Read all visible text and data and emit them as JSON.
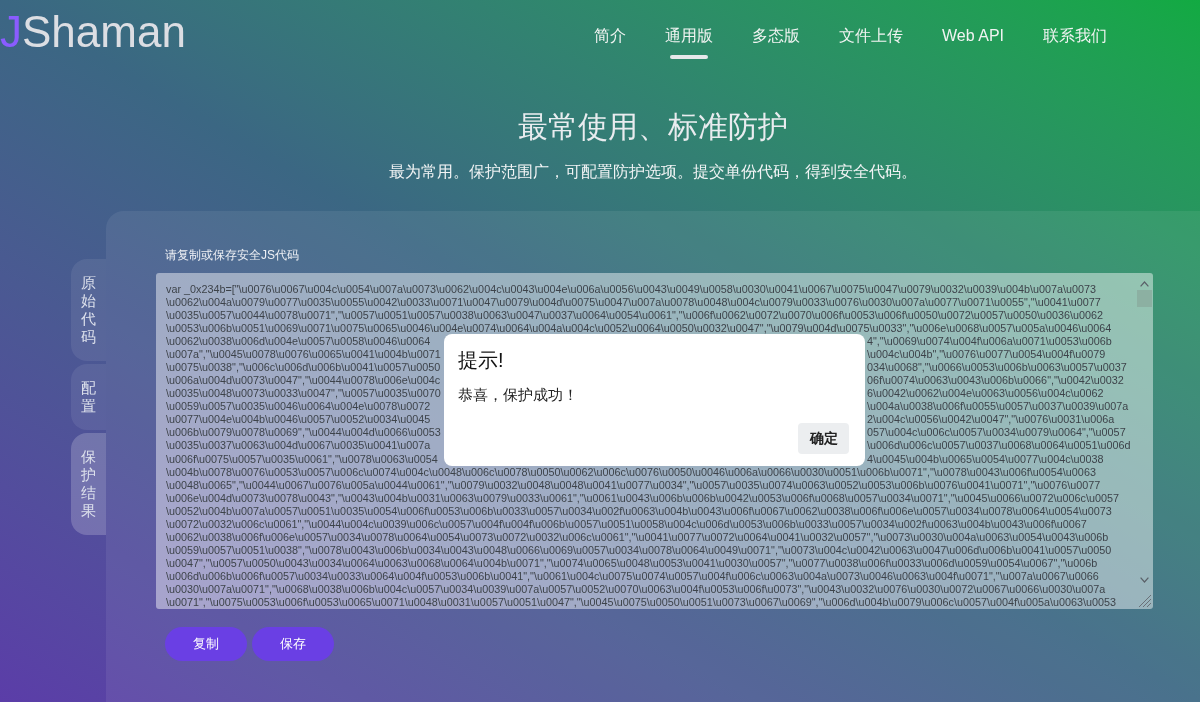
{
  "logo": {
    "accent": "J",
    "text": "Shaman"
  },
  "nav": [
    {
      "label": "简介",
      "selected": false
    },
    {
      "label": "通用版",
      "selected": true
    },
    {
      "label": "多态版",
      "selected": false
    },
    {
      "label": "文件上传",
      "selected": false
    },
    {
      "label": "Web API",
      "selected": false
    },
    {
      "label": "联系我们",
      "selected": false
    }
  ],
  "hero": {
    "title": "最常使用、标准防护",
    "subtitle": "最为常用。保护范围广，可配置防护选项。提交单份代码，得到安全代码。"
  },
  "side_tabs": [
    {
      "label": "原始代码",
      "selected": false
    },
    {
      "label": "配置",
      "selected": false
    },
    {
      "label": "保护结果",
      "selected": true
    }
  ],
  "output": {
    "label": "请复制或保存安全JS代码",
    "lines": [
      {
        "kind": "full",
        "text": "var _0x234b=[\"\\u0076\\u0067\\u004c\\u0054\\u007a\\u0073\\u0062\\u004c\\u0043\\u004e\\u006a\\u0056\\u0043\\u0049\\u0058\\u0030\\u0041\\u0067\\u0075\\u0047\\u0079\\u0032\\u0039\\u004b\\u007a\\u0073"
      },
      {
        "kind": "full",
        "text": "\\u0062\\u004a\\u0079\\u0077\\u0035\\u0055\\u0042\\u0033\\u0071\\u0047\\u0079\\u004d\\u0075\\u0047\\u007a\\u0078\\u0048\\u004c\\u0079\\u0033\\u0076\\u0030\\u007a\\u0077\\u0071\\u0055\",\"\\u0041\\u0077"
      },
      {
        "kind": "full",
        "text": "\\u0035\\u0057\\u0044\\u0078\\u0071\",\"\\u0057\\u0051\\u0057\\u0038\\u0063\\u0047\\u0037\\u0064\\u0054\\u0061\",\"\\u006f\\u0062\\u0072\\u0070\\u006f\\u0053\\u006f\\u0050\\u0072\\u0057\\u0050\\u0036\\u0062"
      },
      {
        "kind": "full",
        "text": "\\u0053\\u006b\\u0051\\u0069\\u0071\\u0075\\u0065\\u0046\\u004e\\u0074\\u0064\\u004a\\u004c\\u0052\\u0064\\u0050\\u0032\\u0047\",\"\\u0079\\u004d\\u0075\\u0033\",\"\\u006e\\u0068\\u0057\\u005a\\u0046\\u0064"
      },
      {
        "kind": "split",
        "left": "\\u0062\\u0038\\u006d\\u004e\\u0057\\u0058\\u0046\\u0064",
        "right": "4\",\"\\u0069\\u0074\\u004f\\u006a\\u0071\\u0053\\u006b"
      },
      {
        "kind": "split",
        "left": "\\u007a\",\"\\u0045\\u0078\\u0076\\u0065\\u0041\\u004b\\u0071",
        "right": "\\u004c\\u004b\",\"\\u0076\\u0077\\u0054\\u004f\\u0079"
      },
      {
        "kind": "split",
        "left": "\\u0075\\u0038\",\"\\u006c\\u006d\\u006b\\u0041\\u0057\\u0050",
        "right": "034\\u0068\",\"\\u0066\\u0053\\u006b\\u0063\\u0057\\u0037"
      },
      {
        "kind": "split",
        "left": "\\u006a\\u004d\\u0073\\u0047\",\"\\u0044\\u0078\\u006e\\u004c",
        "right": "06f\\u0074\\u0063\\u0043\\u006b\\u0066\",\"\\u0042\\u0032"
      },
      {
        "kind": "split",
        "left": "\\u0035\\u0048\\u0073\\u0033\\u0047\",\"\\u0057\\u0035\\u0070",
        "right": "6\\u0042\\u0062\\u004e\\u0063\\u0056\\u004c\\u0062"
      },
      {
        "kind": "split",
        "left": "\\u0059\\u0057\\u0035\\u0046\\u0064\\u004e\\u0078\\u0072",
        "right": "\\u004a\\u0038\\u006f\\u0055\\u0057\\u0037\\u0039\\u007a"
      },
      {
        "kind": "split",
        "left": "\\u0077\\u004e\\u004b\\u0046\\u0057\\u0052\\u0034\\u0045",
        "right": "2\\u004c\\u0056\\u0042\\u0047\",\"\\u0076\\u0031\\u006a"
      },
      {
        "kind": "split",
        "left": "\\u006b\\u0079\\u0078\\u0069\",\"\\u0044\\u004d\\u0066\\u0053",
        "right": "057\\u004c\\u006c\\u0057\\u0034\\u0079\\u0064\",\"\\u0057"
      },
      {
        "kind": "split",
        "left": "\\u0035\\u0037\\u0063\\u004d\\u0067\\u0035\\u0041\\u007a",
        "right": "\\u006d\\u006c\\u0057\\u0037\\u0068\\u0064\\u0051\\u006d"
      },
      {
        "kind": "split",
        "left": "\\u006f\\u0075\\u0057\\u0035\\u0061\",\"\\u0078\\u0063\\u0054",
        "right": "4\\u0045\\u004b\\u0065\\u0054\\u0077\\u004c\\u0038"
      },
      {
        "kind": "full",
        "text": "\\u004b\\u0078\\u0076\\u0053\\u0057\\u006c\\u0074\\u004c\\u0048\\u006c\\u0078\\u0050\\u0062\\u006c\\u0076\\u0050\\u0046\\u006a\\u0066\\u0030\\u0051\\u006b\\u0071\",\"\\u0078\\u0043\\u006f\\u0054\\u0063"
      },
      {
        "kind": "full",
        "text": "\\u0048\\u0065\",\"\\u0044\\u0067\\u0076\\u005a\\u0044\\u0061\",\"\\u0079\\u0032\\u0048\\u0048\\u0041\\u0077\\u0034\",\"\\u0057\\u0035\\u0074\\u0063\\u0052\\u0053\\u006b\\u0076\\u0041\\u0071\",\"\\u0076\\u0077"
      },
      {
        "kind": "full",
        "text": "\\u006e\\u004d\\u0073\\u0078\\u0043\",\"\\u0043\\u004b\\u0031\\u0063\\u0079\\u0033\\u0061\",\"\\u0061\\u0043\\u006b\\u006b\\u0042\\u0053\\u006f\\u0068\\u0057\\u0034\\u0071\",\"\\u0045\\u0066\\u0072\\u006c\\u0057"
      },
      {
        "kind": "full",
        "text": "\\u0052\\u004b\\u007a\\u0057\\u0051\\u0035\\u0054\\u006f\\u0053\\u006b\\u0033\\u0057\\u0034\\u002f\\u0063\\u004b\\u0043\\u006f\\u0067\\u0062\\u0038\\u006f\\u006e\\u0057\\u0034\\u0078\\u0064\\u0054\\u0073"
      },
      {
        "kind": "full",
        "text": "\\u0072\\u0032\\u006c\\u0061\",\"\\u0044\\u004c\\u0039\\u006c\\u0057\\u004f\\u004f\\u006b\\u0057\\u0051\\u0058\\u004c\\u006d\\u0053\\u006b\\u0033\\u0057\\u0034\\u002f\\u0063\\u004b\\u0043\\u006f\\u0067"
      },
      {
        "kind": "full",
        "text": "\\u0062\\u0038\\u006f\\u006e\\u0057\\u0034\\u0078\\u0064\\u0054\\u0073\\u0072\\u0032\\u006c\\u0061\",\"\\u0041\\u0077\\u0072\\u0064\\u0041\\u0032\\u0057\",\"\\u0073\\u0030\\u004a\\u0063\\u0054\\u0043\\u006b"
      },
      {
        "kind": "full",
        "text": "\\u0059\\u0057\\u0051\\u0038\",\"\\u0078\\u0043\\u006b\\u0034\\u0043\\u0048\\u0066\\u0069\\u0057\\u0034\\u0078\\u0064\\u0049\\u0071\",\"\\u0073\\u004c\\u0042\\u0063\\u0047\\u006d\\u006b\\u0041\\u0057\\u0050"
      },
      {
        "kind": "full",
        "text": "\\u0047\",\"\\u0057\\u0050\\u0043\\u0034\\u0064\\u0063\\u0068\\u0064\\u004b\\u0071\",\"\\u0074\\u0065\\u0048\\u0053\\u0041\\u0030\\u0057\",\"\\u0077\\u0038\\u006f\\u0033\\u006d\\u0059\\u0054\\u0067\",\"\\u006b"
      },
      {
        "kind": "full",
        "text": "\\u006d\\u006b\\u006f\\u0057\\u0034\\u0033\\u0064\\u004f\\u0053\\u006b\\u0041\",\"\\u0061\\u004c\\u0075\\u0074\\u0057\\u004f\\u006c\\u0063\\u004a\\u0073\\u0046\\u0063\\u004f\\u0071\",\"\\u007a\\u0067\\u0066"
      },
      {
        "kind": "full",
        "text": "\\u0030\\u007a\\u0071\",\"\\u0068\\u0038\\u006b\\u004c\\u0057\\u0034\\u0039\\u007a\\u0057\\u0052\\u0070\\u0063\\u004f\\u0053\\u006f\\u0073\",\"\\u0043\\u0032\\u0076\\u0030\\u0072\\u0067\\u0066\\u0030\\u007a"
      },
      {
        "kind": "full",
        "text": "\\u0071\",\"\\u0075\\u0053\\u006f\\u0053\\u0065\\u0071\\u0048\\u0031\\u0057\\u0051\\u0047\",\"\\u0045\\u0075\\u0050\\u0051\\u0073\\u0067\\u0069\",\"\\u006d\\u004b\\u0079\\u006c\\u0057\\u004f\\u005a\\u0063\\u0053"
      }
    ]
  },
  "actions": [
    "复制",
    "保存"
  ],
  "dialog": {
    "title": "提示!",
    "message": "恭喜，保护成功！",
    "button": "确定"
  }
}
